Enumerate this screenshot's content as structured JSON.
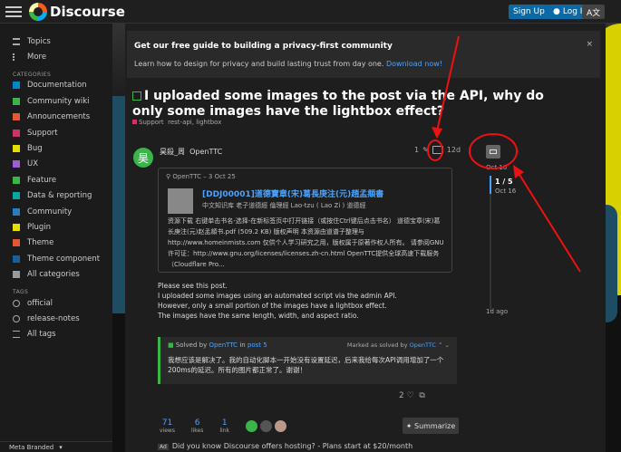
{
  "header": {
    "brand": "Discourse",
    "signup": "Sign Up",
    "login": "Log In",
    "lang": "A文"
  },
  "sidebar": {
    "top": [
      {
        "label": "Topics"
      },
      {
        "label": "More"
      }
    ],
    "categories_title": "CATEGORIES",
    "categories": [
      {
        "label": "Documentation",
        "color": "#0088cc"
      },
      {
        "label": "Community wiki",
        "color": "#3ab54a"
      },
      {
        "label": "Announcements",
        "color": "#e45735"
      },
      {
        "label": "Support",
        "color": "#c36"
      },
      {
        "label": "Bug",
        "color": "#e9dd00"
      },
      {
        "label": "UX",
        "color": "#9d5ecf"
      },
      {
        "label": "Feature",
        "color": "#3ab54a"
      },
      {
        "label": "Data & reporting",
        "color": "#0ea5a0"
      },
      {
        "label": "Community",
        "color": "#2b7bbf"
      },
      {
        "label": "Plugin",
        "color": "#e9dd00"
      },
      {
        "label": "Theme",
        "color": "#e45735"
      },
      {
        "label": "Theme component",
        "color": "#1e5d9b"
      },
      {
        "label": "All categories",
        "color": "#999"
      }
    ],
    "tags_title": "TAGS",
    "tags": [
      {
        "label": "official"
      },
      {
        "label": "release-notes"
      },
      {
        "label": "All tags"
      }
    ],
    "footer": "Meta Branded"
  },
  "banner": {
    "title": "Get our free guide to building a privacy-first community",
    "desc": "Learn how to design for privacy and build lasting trust from day one.",
    "link": "Download now!",
    "close": "×"
  },
  "topic": {
    "title": "I uploaded some images to the post via the API, why do only some images have the lightbox effect?",
    "category": "Support",
    "tags": "rest-api, lightbox"
  },
  "post": {
    "avatar": "昊",
    "username": "昊殺_周",
    "handle": "OpenTTC",
    "edits": "1",
    "age": "12d",
    "onebox": {
      "source": "OpenTTC – 3 Oct 25",
      "title": "[DDJ00001]道德寶章(宋)葛長庚注(元)趙孟頫書",
      "cat": "中文知识库  老子道德經 倫理經 Lao-tzu ( Lao Zi ) 道德經",
      "body": "资源下载 右键单击书名-选择-在新标签页中打开链接（或按住Ctrl键后点击书名） 道德宝章(宋)葛长庚注(元)赵孟頫书.pdf (509.2 KB) 版权声明 本资源由道谱子整理与 http://www.homeinmists.com 仅供个人学习研究之用，版权属于原著作权人所有。 请参阅GNU许可证：http://www.gnu.org/licenses/licenses.zh-cn.html OpenTTC提供全球高速下载服务（Cloudflare Pro..."
    },
    "lines": [
      "Please see this post.",
      "I uploaded some images using an automated script via the admin API.",
      "However, only a small portion of the images have a lightbox effect.",
      "The images have the same length, width, and aspect ratio."
    ],
    "solved": {
      "prefix": "Solved by",
      "by": "OpenTTC",
      "in": "in",
      "post": "post 5",
      "marked": "Marked as solved by",
      "marked_by": "OpenTTC",
      "body": "我想应该是解决了。我的自动化脚本一开始没有设置延迟，后来我给每次API调用增加了一个200ms的延迟。所有的图片都正常了。谢谢！"
    },
    "likes_count": "2",
    "stats": [
      {
        "n": "71",
        "l": "views"
      },
      {
        "n": "6",
        "l": "likes"
      },
      {
        "n": "1",
        "l": "link"
      }
    ],
    "summarize": "Summarize"
  },
  "timeline": {
    "start": "Oct 16",
    "position": "1 / 5",
    "date": "Oct 16",
    "ago": "1d ago"
  },
  "ad": {
    "tag": "Ad",
    "text": "Did you know Discourse offers hosting? - Plans start at $20/month"
  }
}
